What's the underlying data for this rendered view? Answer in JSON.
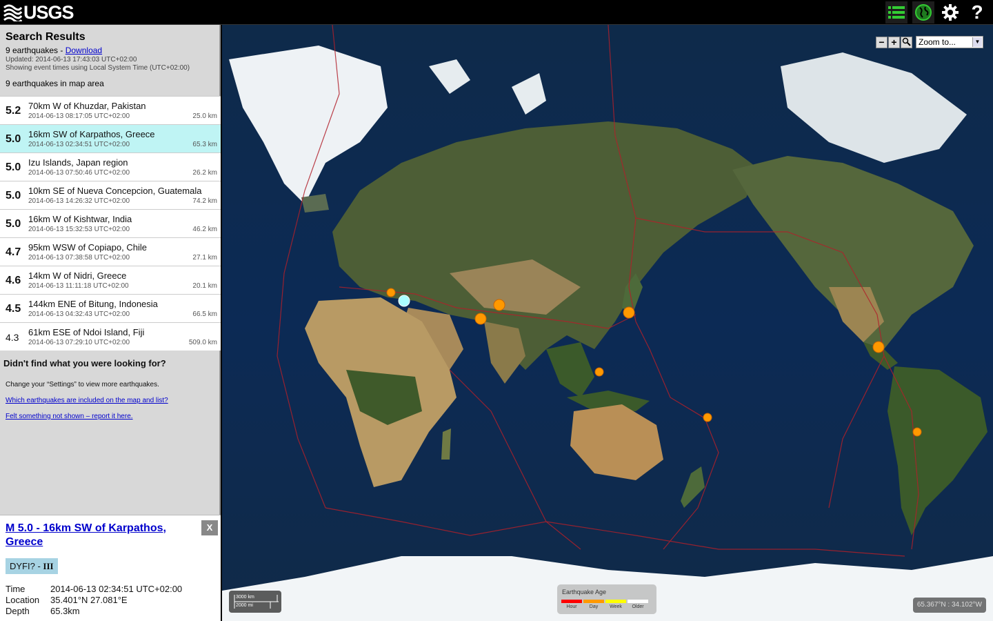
{
  "header": {
    "logo_text": "USGS",
    "buttons": [
      {
        "name": "list-icon"
      },
      {
        "name": "globe-icon"
      },
      {
        "name": "gear-icon"
      },
      {
        "name": "help-icon"
      }
    ],
    "accent": "#33cc33"
  },
  "results": {
    "title": "Search Results",
    "count_text": "9 earthquakes - ",
    "download_label": "Download",
    "updated": "Updated: 2014-06-13 17:43:03 UTC+02:00",
    "time_note": "Showing event times using Local System Time (UTC+02:00)",
    "in_map": "9 earthquakes in map area"
  },
  "earthquakes": [
    {
      "mag": "5.2",
      "place": "70km W of Khuzdar, Pakistan",
      "time": "2014-06-13 08:17:05 UTC+02:00",
      "depth": "25.0 km"
    },
    {
      "mag": "5.0",
      "place": "16km SW of Karpathos, Greece",
      "time": "2014-06-13 02:34:51 UTC+02:00",
      "depth": "65.3 km"
    },
    {
      "mag": "5.0",
      "place": "Izu Islands, Japan region",
      "time": "2014-06-13 07:50:46 UTC+02:00",
      "depth": "26.2 km"
    },
    {
      "mag": "5.0",
      "place": "10km SE of Nueva Concepcion, Guatemala",
      "time": "2014-06-13 14:26:32 UTC+02:00",
      "depth": "74.2 km"
    },
    {
      "mag": "5.0",
      "place": "16km W of Kishtwar, India",
      "time": "2014-06-13 15:32:53 UTC+02:00",
      "depth": "46.2 km"
    },
    {
      "mag": "4.7",
      "place": "95km WSW of Copiapo, Chile",
      "time": "2014-06-13 07:38:58 UTC+02:00",
      "depth": "27.1 km"
    },
    {
      "mag": "4.6",
      "place": "14km W of Nidri, Greece",
      "time": "2014-06-13 11:11:18 UTC+02:00",
      "depth": "20.1 km"
    },
    {
      "mag": "4.5",
      "place": "144km ENE of Bitung, Indonesia",
      "time": "2014-06-13 04:32:43 UTC+02:00",
      "depth": "66.5 km"
    },
    {
      "mag": "4.3",
      "place": "61km ESE of Ndoi Island, Fiji",
      "time": "2014-06-13 07:29:10 UTC+02:00",
      "depth": "509.0 km"
    }
  ],
  "selected_index": 1,
  "not_found": {
    "heading": "Didn't find what you were looking for?",
    "settings_hint": "Change your “Settings” to view more earthquakes.",
    "link1": "Which earthquakes are included on the map and list?",
    "link2": "Felt something not shown – report it here."
  },
  "info": {
    "title": "M 5.0 - 16km SW of Karpathos, Greece",
    "close": "X",
    "dyfi_label": "DYFI? - ",
    "dyfi_value": "III",
    "time_label": "Time",
    "time_value": "2014-06-13 02:34:51 UTC+02:00",
    "location_label": "Location",
    "location_value": "35.401°N 27.081°E",
    "depth_label": "Depth",
    "depth_value": "65.3km"
  },
  "map": {
    "zoom_out": "−",
    "zoom_in": "+",
    "zoom_placeholder": "Zoom to...",
    "scale_km": "3000 km",
    "scale_mi": "2000 mi",
    "legend_title": "Earthquake Age",
    "legend": [
      {
        "label": "Hour",
        "color": "#ff0000"
      },
      {
        "label": "Day",
        "color": "#ff9900"
      },
      {
        "label": "Week",
        "color": "#ffff00"
      },
      {
        "label": "Older",
        "color": "#ffffff"
      }
    ],
    "coordinates": "65.367°N : 34.102°W",
    "marker_color": "#ff9900",
    "selected_marker_color": "#aaffff"
  }
}
